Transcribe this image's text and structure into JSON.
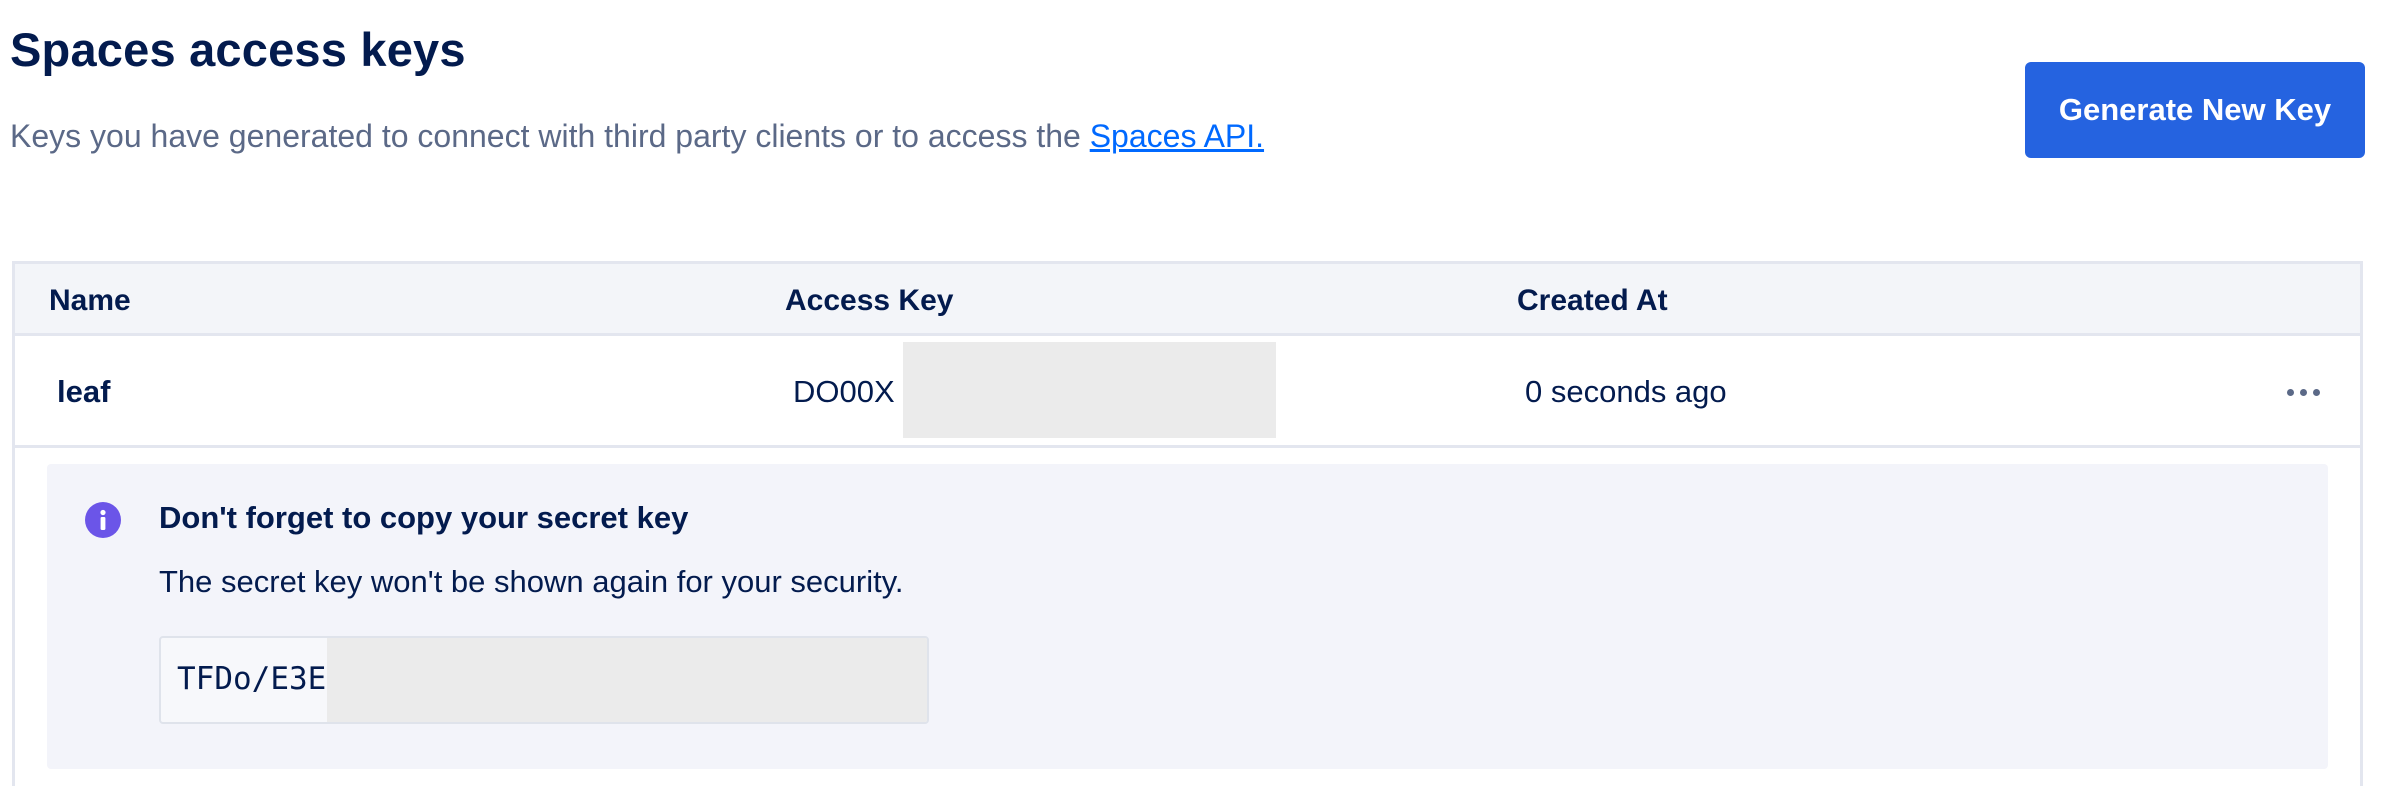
{
  "header": {
    "title": "Spaces access keys",
    "description": "Keys you have generated to connect with third party clients or to access the ",
    "link_label": "Spaces API.",
    "generate_button_label": "Generate New Key"
  },
  "table": {
    "columns": [
      "Name",
      "Access Key",
      "Created At"
    ],
    "rows": [
      {
        "name": "leaf",
        "access_key": "DO00X",
        "created_at": "0 seconds ago"
      }
    ]
  },
  "notice": {
    "icon": "info-icon",
    "title": "Don't forget to copy your secret key",
    "text": "The secret key won't be shown again for your security.",
    "secret_key": "TFDo/E3E"
  },
  "colors": {
    "primary": "#2563e0",
    "text_dark": "#031b4e",
    "text_muted": "#5b6987",
    "link": "#0069ff",
    "info_icon": "#6b55e8",
    "notice_bg": "#f3f4fa",
    "redaction": "#ebebeb"
  }
}
